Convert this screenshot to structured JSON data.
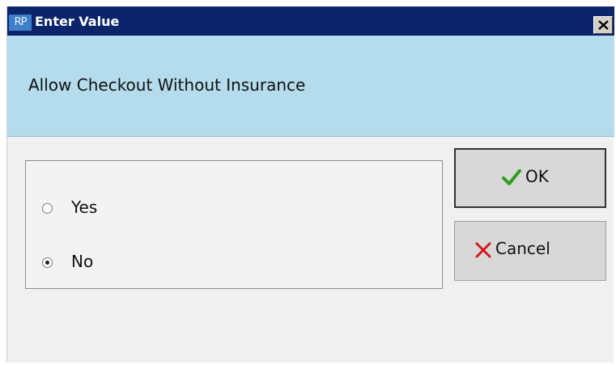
{
  "window": {
    "app_icon_text": "RP",
    "title": "Enter Value"
  },
  "prompt": {
    "text": "Allow Checkout Without Insurance"
  },
  "options": {
    "items": [
      {
        "label": "Yes",
        "selected": false
      },
      {
        "label": "No",
        "selected": true
      }
    ]
  },
  "buttons": {
    "ok_label": "OK",
    "cancel_label": "Cancel",
    "ok_icon": "checkmark-icon",
    "cancel_icon": "x-icon"
  },
  "colors": {
    "titlebar": "#0b246a",
    "prompt_panel": "#b4dcec",
    "check": "#2e9e1a",
    "cancel_x": "#d11b1b"
  }
}
